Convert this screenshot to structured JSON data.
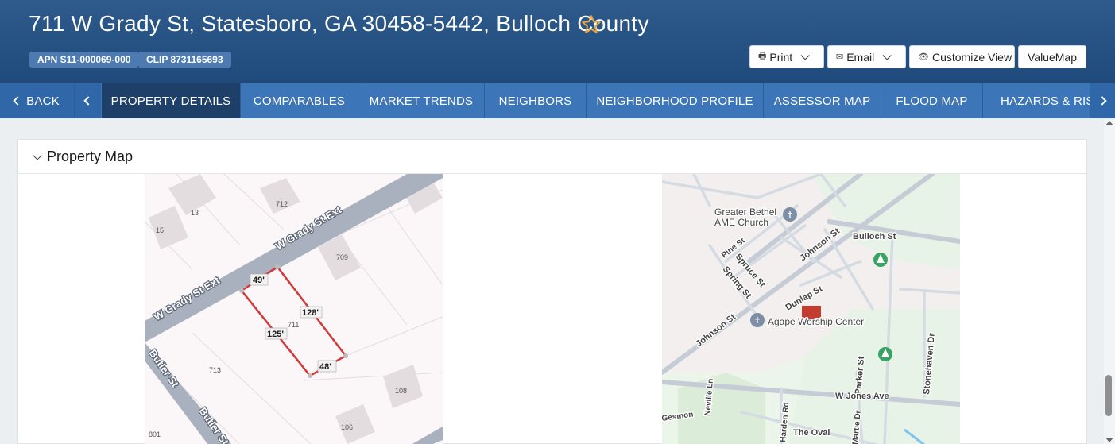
{
  "header": {
    "address": "711 W Grady St, Statesboro, GA 30458-5442, Bulloch County",
    "apn": "APN S11-000069-000",
    "clip": "CLIP 8731165693",
    "buttons": {
      "print": "Print",
      "email": "Email",
      "customize": "Customize View",
      "valuemap": "ValueMap"
    },
    "colors": {
      "header_bg": "#2a5587",
      "tab_bg": "#3d76b8",
      "active_tab": "#1e3f68",
      "star": "#e8a33c"
    }
  },
  "tabs": {
    "back": "BACK",
    "items": [
      "PROPERTY DETAILS",
      "COMPARABLES",
      "MARKET TRENDS",
      "NEIGHBORS",
      "NEIGHBORHOOD PROFILE",
      "ASSESSOR MAP",
      "FLOOD MAP",
      "HAZARDS & RISK"
    ],
    "active": "PROPERTY DETAILS"
  },
  "section": {
    "title": "Property Map"
  },
  "parcel_map": {
    "streets": [
      "W Grady St Ext",
      "W Grady St Ext",
      "Butler St",
      "Butler St"
    ],
    "lots": [
      "13",
      "712",
      "15",
      "709",
      "711",
      "713",
      "108",
      "106",
      "801"
    ],
    "dimensions": [
      "49'",
      "128'",
      "125'",
      "48'"
    ]
  },
  "street_map": {
    "labels": {
      "church": "Greater Bethel\nAME Church",
      "bulloch": "Bulloch St",
      "johnson1": "Johnson St",
      "johnson2": "Johnson St",
      "pine": "Pine St",
      "spruce": "Spruce St",
      "spring": "Spring St",
      "dunlap": "Dunlap St",
      "agape": "Agape Worship Center",
      "stonehaven": "Stonehaven Dr",
      "parker": "Parker St",
      "jones": "W Jones Ave",
      "neville": "Neville Ln",
      "harden": "Harden Rd",
      "martie": "Martie Dr",
      "oval": "The Oval",
      "gesmon": "Gesmon"
    }
  }
}
